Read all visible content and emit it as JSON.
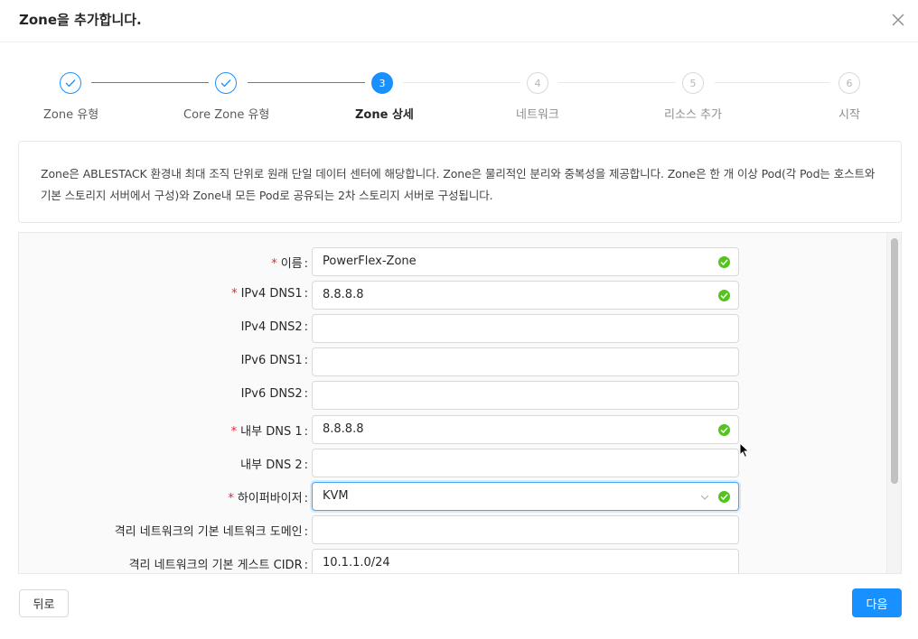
{
  "header": {
    "title": "Zone을 추가합니다."
  },
  "steps": [
    {
      "label": "Zone 유형",
      "number": "1",
      "status": "done"
    },
    {
      "label": "Core Zone 유형",
      "number": "2",
      "status": "done"
    },
    {
      "label": "Zone 상세",
      "number": "3",
      "status": "active"
    },
    {
      "label": "네트워크",
      "number": "4",
      "status": "wait"
    },
    {
      "label": "리소스 추가",
      "number": "5",
      "status": "wait"
    },
    {
      "label": "시작",
      "number": "6",
      "status": "wait"
    }
  ],
  "description": "Zone은 ABLESTACK 환경내 최대 조직 단위로 원래 단일 데이터 센터에 해당합니다. Zone은 물리적인 분리와 중복성을 제공합니다. Zone은 한 개 이상 Pod(각 Pod는 호스트와 기본 스토리지 서버에서 구성)와 Zone내 모든 Pod로 공유되는 2차 스토리지 서버로 구성됩니다.",
  "form": {
    "fields": [
      {
        "label": "이름",
        "required": true,
        "value": "PowerFlex-Zone",
        "valid": true
      },
      {
        "label": "IPv4 DNS1",
        "required": true,
        "value": "8.8.8.8",
        "valid": true
      },
      {
        "label": "IPv4 DNS2",
        "required": false,
        "value": "",
        "valid": false
      },
      {
        "label": "IPv6 DNS1",
        "required": false,
        "value": "",
        "valid": false
      },
      {
        "label": "IPv6 DNS2",
        "required": false,
        "value": "",
        "valid": false
      },
      {
        "label": "내부 DNS 1",
        "required": true,
        "value": "8.8.8.8",
        "valid": true
      },
      {
        "label": "내부 DNS 2",
        "required": false,
        "value": "",
        "valid": false
      },
      {
        "label": "하이퍼바이저",
        "required": true,
        "value": "KVM",
        "valid": true,
        "type": "select"
      },
      {
        "label": "격리 네트워크의 기본 네트워크 도메인",
        "required": false,
        "value": "",
        "valid": false
      },
      {
        "label": "격리 네트워크의 기본 게스트 CIDR",
        "required": false,
        "value": "10.1.1.0/24",
        "valid": false
      }
    ],
    "colon": ":"
  },
  "footer": {
    "back_label": "뒤로",
    "next_label": "다음"
  },
  "colors": {
    "primary": "#1890ff",
    "success": "#52c41a",
    "required": "#f5222d"
  }
}
